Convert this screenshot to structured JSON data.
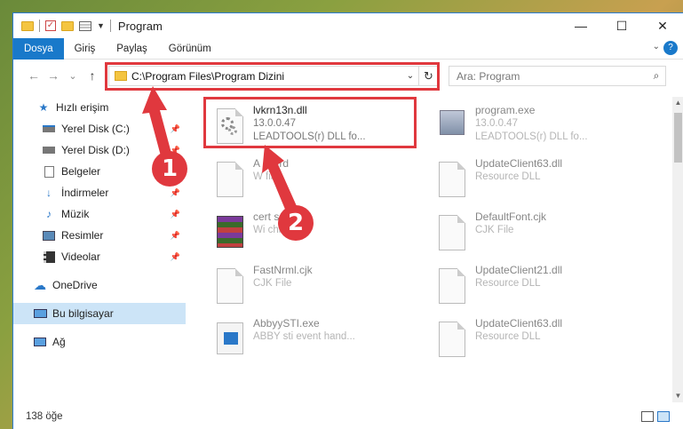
{
  "window": {
    "title": "Program"
  },
  "window_controls": {
    "minimize": "—",
    "maximize": "☐",
    "close": "✕"
  },
  "ribbon": {
    "tabs": [
      "Dosya",
      "Giriş",
      "Paylaş",
      "Görünüm"
    ],
    "active_tab": "Dosya",
    "help": "?"
  },
  "navigation": {
    "back": "←",
    "forward": "→",
    "recent": "⌄",
    "up": "↑",
    "address": "C:\\Program Files\\Program Dizini",
    "search_placeholder": "Ara: Program"
  },
  "sidebar": {
    "items": [
      {
        "label": "Hızlı erişim",
        "icon": "star-icon",
        "pinned": false
      },
      {
        "label": "Yerel Disk (C:)",
        "icon": "drive-icon",
        "pinned": true
      },
      {
        "label": "Yerel Disk (D:)",
        "icon": "drive-icon",
        "pinned": true
      },
      {
        "label": "Belgeler",
        "icon": "documents-icon",
        "pinned": true
      },
      {
        "label": "İndirmeler",
        "icon": "download-icon",
        "pinned": true
      },
      {
        "label": "Müzik",
        "icon": "music-icon",
        "pinned": true
      },
      {
        "label": "Resimler",
        "icon": "pictures-icon",
        "pinned": true
      },
      {
        "label": "Videolar",
        "icon": "videos-icon",
        "pinned": true
      },
      {
        "label": "OneDrive",
        "icon": "cloud-icon",
        "pinned": false
      },
      {
        "label": "Bu bilgisayar",
        "icon": "computer-icon",
        "pinned": false,
        "selected": true
      },
      {
        "label": "Ağ",
        "icon": "network-icon",
        "pinned": false
      }
    ]
  },
  "files": [
    {
      "name": "lvkrn13n.dll",
      "line2": "13.0.0.47",
      "line3": "LEADTOOLS(r) DLL fo...",
      "icon": "dll-gear-icon"
    },
    {
      "name": "program.exe",
      "line2": "13.0.0.47",
      "line3": "LEADTOOLS(r) DLL fo...",
      "icon": "program-icon"
    },
    {
      "name": "A    e.wrd",
      "line2": "W    file",
      "line3": "",
      "icon": "blank-file-icon"
    },
    {
      "name": "UpdateClient63.dll",
      "line2": "Resource DLL",
      "line3": "",
      "icon": "blank-file-icon"
    },
    {
      "name": "cert    s.cab",
      "line2": "Wi        chive",
      "line3": "",
      "icon": "rar-archive-icon"
    },
    {
      "name": "DefaultFont.cjk",
      "line2": "CJK File",
      "line3": "",
      "icon": "blank-file-icon"
    },
    {
      "name": "FastNrml.cjk",
      "line2": "CJK File",
      "line3": "",
      "icon": "blank-file-icon"
    },
    {
      "name": "UpdateClient21.dll",
      "line2": "Resource DLL",
      "line3": "",
      "icon": "blank-file-icon"
    },
    {
      "name": "AbbyySTI.exe",
      "line2": "ABBY sti event hand...",
      "line3": "",
      "icon": "exe-icon"
    },
    {
      "name": "UpdateClient63.dll",
      "line2": "Resource DLL",
      "line3": "",
      "icon": "blank-file-icon"
    }
  ],
  "status": {
    "item_count": "138 öğe"
  },
  "annotations": {
    "step1": "1",
    "step2": "2",
    "color": "#e0383e"
  }
}
